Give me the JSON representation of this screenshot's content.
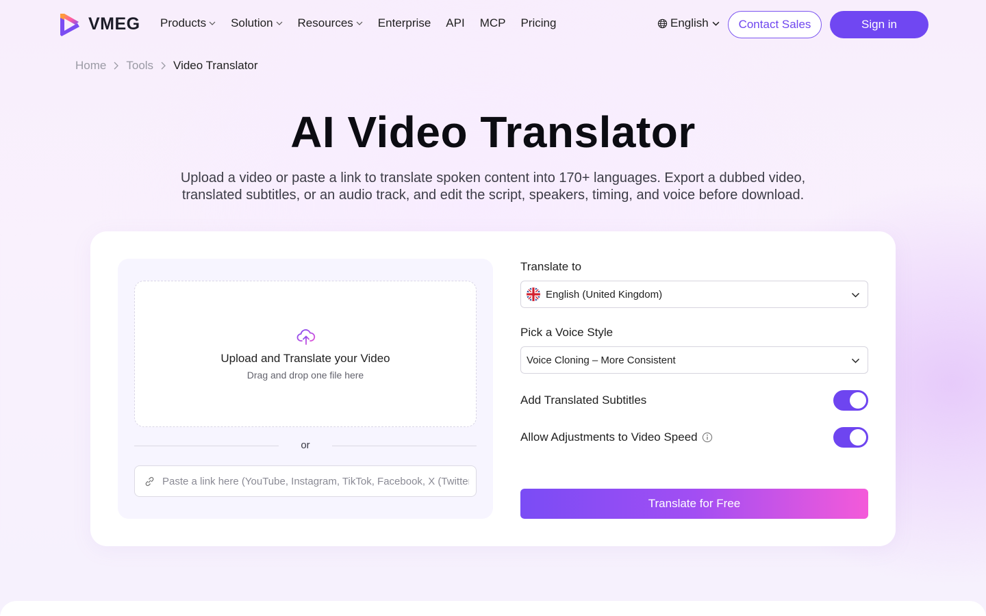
{
  "header": {
    "brand": "VMEG",
    "nav": [
      {
        "label": "Products",
        "has_dropdown": true
      },
      {
        "label": "Solution",
        "has_dropdown": true
      },
      {
        "label": "Resources",
        "has_dropdown": true
      },
      {
        "label": "Enterprise",
        "has_dropdown": false
      },
      {
        "label": "API",
        "has_dropdown": false
      },
      {
        "label": "MCP",
        "has_dropdown": false
      },
      {
        "label": "Pricing",
        "has_dropdown": false
      }
    ],
    "language": "English",
    "contact_label": "Contact Sales",
    "signin_label": "Sign in"
  },
  "breadcrumb": {
    "items": [
      "Home",
      "Tools",
      "Video Translator"
    ]
  },
  "hero": {
    "title": "AI Video Translator",
    "subtitle_line1": "Upload a video or paste a link to translate spoken content into 170+ languages. Export a dubbed video,",
    "subtitle_line2": "translated subtitles, or an audio track, and edit the script, speakers, timing, and voice before download."
  },
  "upload": {
    "title": "Upload and Translate your Video",
    "subtitle": "Drag and drop one file here",
    "or": "or",
    "link_placeholder": "Paste a link here (YouTube, Instagram, TikTok, Facebook, X (Twitter)"
  },
  "options": {
    "translate_to_label": "Translate to",
    "translate_to_value": "English (United Kingdom)",
    "voice_style_label": "Pick a Voice Style",
    "voice_style_value": "Voice Cloning – More Consistent",
    "subtitles_label": "Add Translated Subtitles",
    "subtitles_on": true,
    "speed_label": "Allow Adjustments to Video Speed",
    "speed_on": true,
    "cta": "Translate for Free"
  },
  "colors": {
    "accent": "#7047f2",
    "cta_gradient_start": "#7a4cf5",
    "cta_gradient_end": "#f45ad9"
  },
  "icons": {
    "upload": "cloud-upload-icon",
    "link": "link-icon",
    "globe": "globe-icon",
    "info": "info-icon",
    "flag": "uk-flag-icon"
  }
}
